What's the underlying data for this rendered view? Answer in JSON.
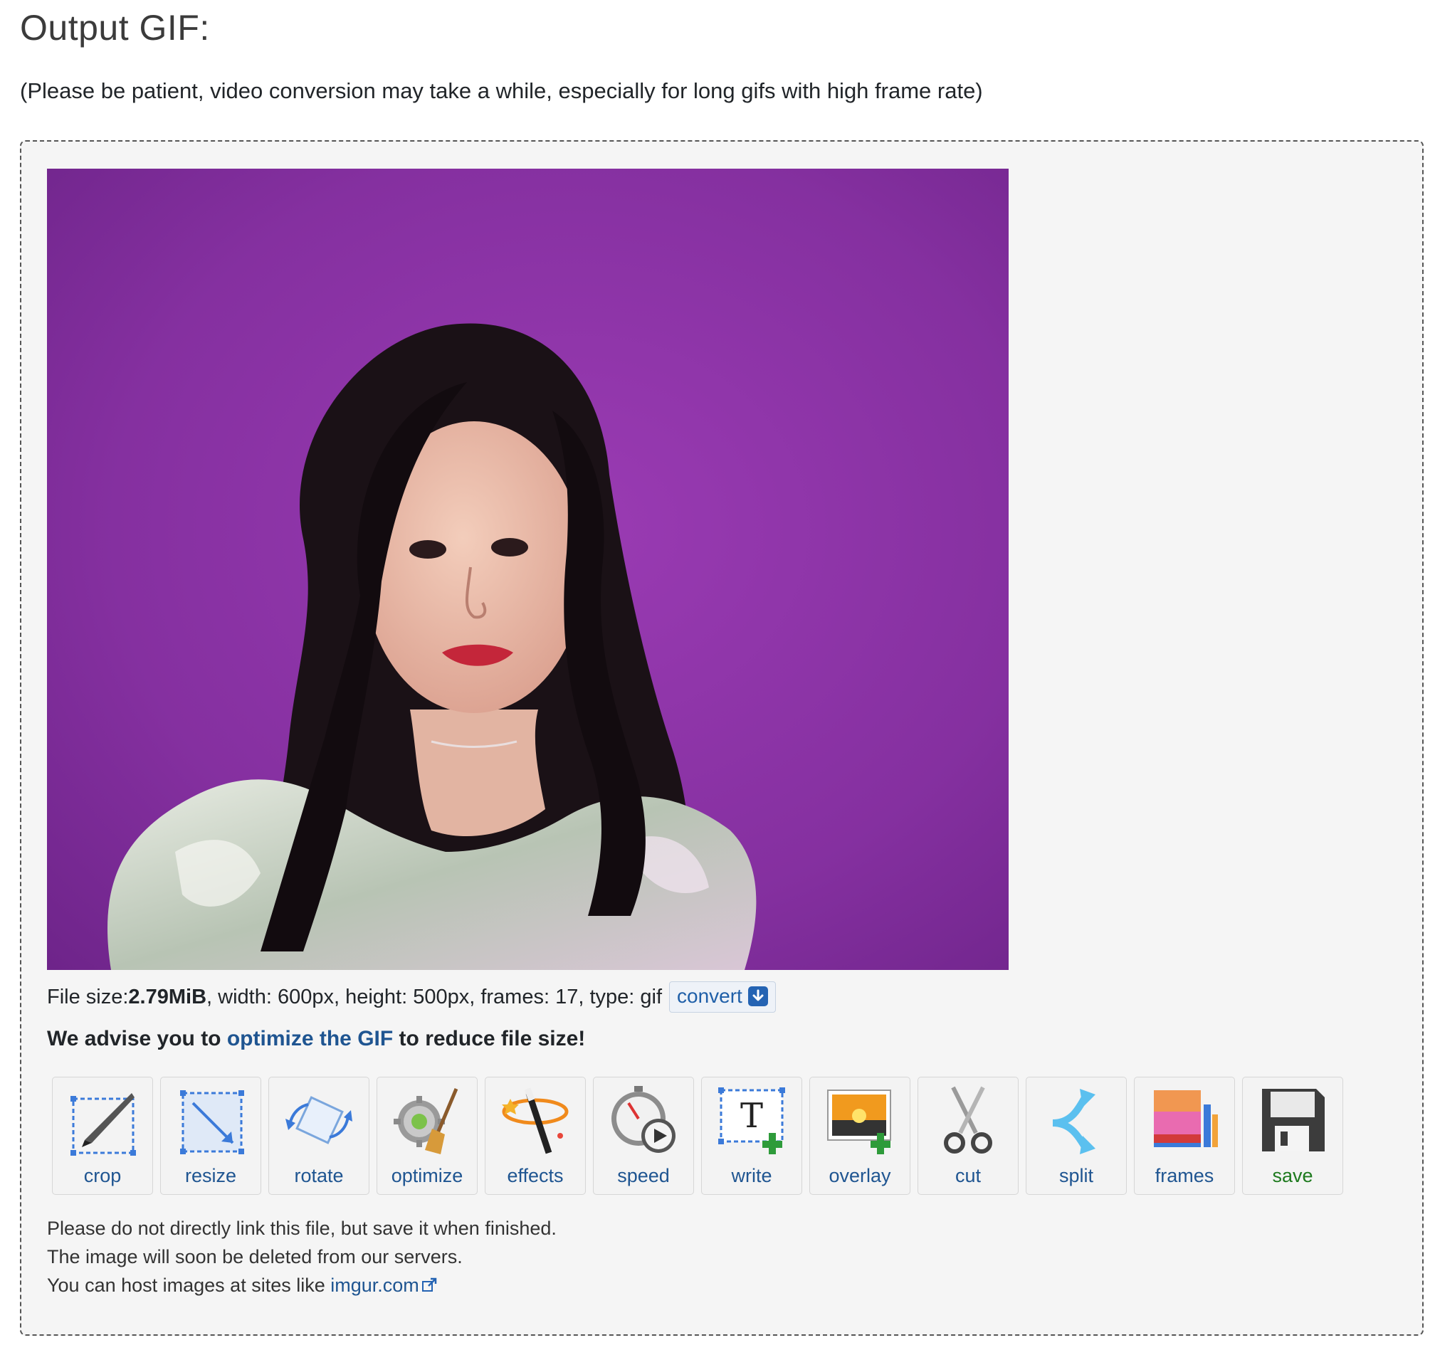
{
  "header": {
    "title": "Output GIF:",
    "notice": "(Please be patient, video conversion may take a while, especially for long gifs with high frame rate)"
  },
  "gif": {
    "icon": "output-gif-image"
  },
  "file_info": {
    "size_prefix": "File size: ",
    "size_value": "2.79MiB",
    "details": ", width: 600px, height: 500px, frames: 17, type: gif",
    "convert_label": "convert",
    "convert_icon": "download-arrow-icon"
  },
  "advice": {
    "prefix": "We advise you to ",
    "link": "optimize the GIF",
    "suffix": " to reduce file size!"
  },
  "tools": [
    {
      "label": "crop",
      "icon": "crop-icon"
    },
    {
      "label": "resize",
      "icon": "resize-icon"
    },
    {
      "label": "rotate",
      "icon": "rotate-icon"
    },
    {
      "label": "optimize",
      "icon": "optimize-icon"
    },
    {
      "label": "effects",
      "icon": "effects-icon"
    },
    {
      "label": "speed",
      "icon": "speed-icon"
    },
    {
      "label": "write",
      "icon": "write-icon"
    },
    {
      "label": "overlay",
      "icon": "overlay-icon"
    },
    {
      "label": "cut",
      "icon": "cut-icon"
    },
    {
      "label": "split",
      "icon": "split-icon"
    },
    {
      "label": "frames",
      "icon": "frames-icon"
    },
    {
      "label": "save",
      "icon": "save-icon"
    }
  ],
  "footer": {
    "line1": "Please do not directly link this file, but save it when finished.",
    "line2": "The image will soon be deleted from our servers.",
    "line3_prefix": "You can host images at sites like ",
    "line3_link": "imgur.com",
    "external_icon": "external-link-icon"
  },
  "colors": {
    "link": "#1f5591",
    "save": "#1e7a1e",
    "background_purple": "#8b2fa0"
  }
}
